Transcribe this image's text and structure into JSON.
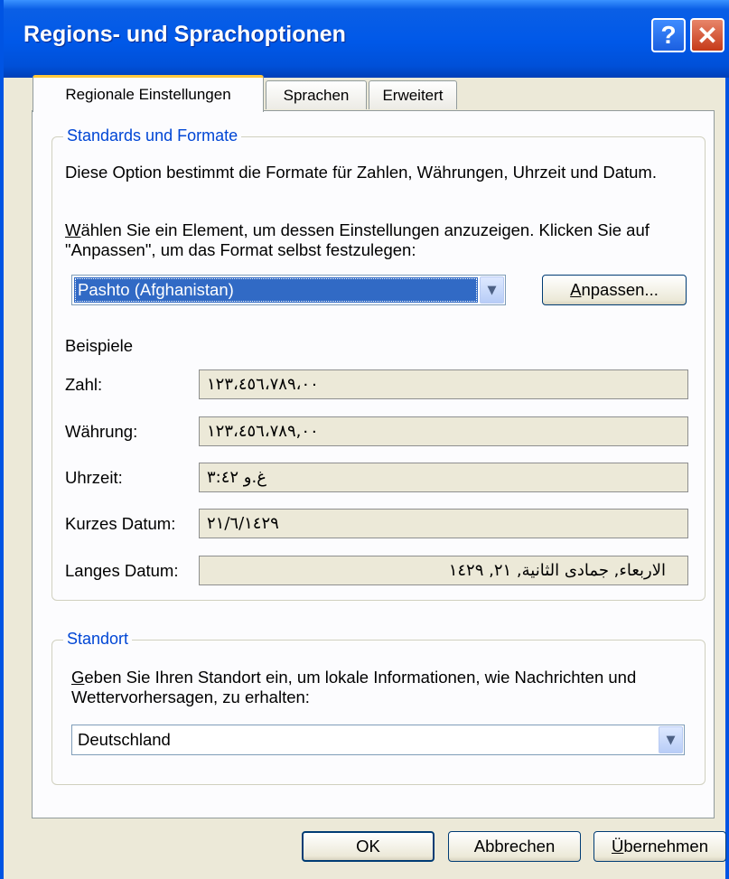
{
  "window": {
    "title": "Regions- und Sprachoptionen",
    "help_icon": "?",
    "close_icon": "✕"
  },
  "tabs": [
    {
      "label": "Regionale Einstellungen",
      "active": true
    },
    {
      "label": "Sprachen",
      "active": false
    },
    {
      "label": "Erweitert",
      "active": false
    }
  ],
  "standards": {
    "group_label": "Standards und Formate",
    "description": "Diese Option bestimmt die Formate für Zahlen, Währungen, Uhrzeit und Datum.",
    "instruction_first": "W",
    "instruction_rest": "ählen Sie ein Element, um dessen Einstellungen anzuzeigen. Klicken Sie auf \"Anpassen\", um das Format selbst festzulegen:",
    "selected_format": "Pashto (Afghanistan)",
    "customize_first": "A",
    "customize_rest": "npassen...",
    "examples_label": "Beispiele",
    "examples": [
      {
        "label": "Zahl:",
        "value": "١٢٣،٤٥٦،٧٨٩،٠٠"
      },
      {
        "label": "Währung:",
        "value": "١٢٣،٤٥٦،٧٨٩,٠٠"
      },
      {
        "label": "Uhrzeit:",
        "value": "غ.و ٣:٤٢"
      },
      {
        "label": "Kurzes Datum:",
        "value": "٢١/٦/١٤٢٩"
      },
      {
        "label": "Langes Datum:",
        "value": "الاربعاء, جمادى الثانية, ٢١, ١٤٢٩"
      }
    ]
  },
  "location": {
    "group_label": "Standort",
    "description_first": "G",
    "description_rest": "eben Sie Ihren Standort ein, um lokale Informationen, wie Nachrichten und Wettervorhersagen, zu erhalten:",
    "selected": "Deutschland"
  },
  "buttons": {
    "ok": "OK",
    "cancel": "Abbrechen",
    "apply_first": "Ü",
    "apply_rest": "bernehmen"
  },
  "colors": {
    "titlebar": "#0058e8",
    "group_label": "#0046d5",
    "selection": "#316ac5",
    "close_button": "#c63a18"
  }
}
